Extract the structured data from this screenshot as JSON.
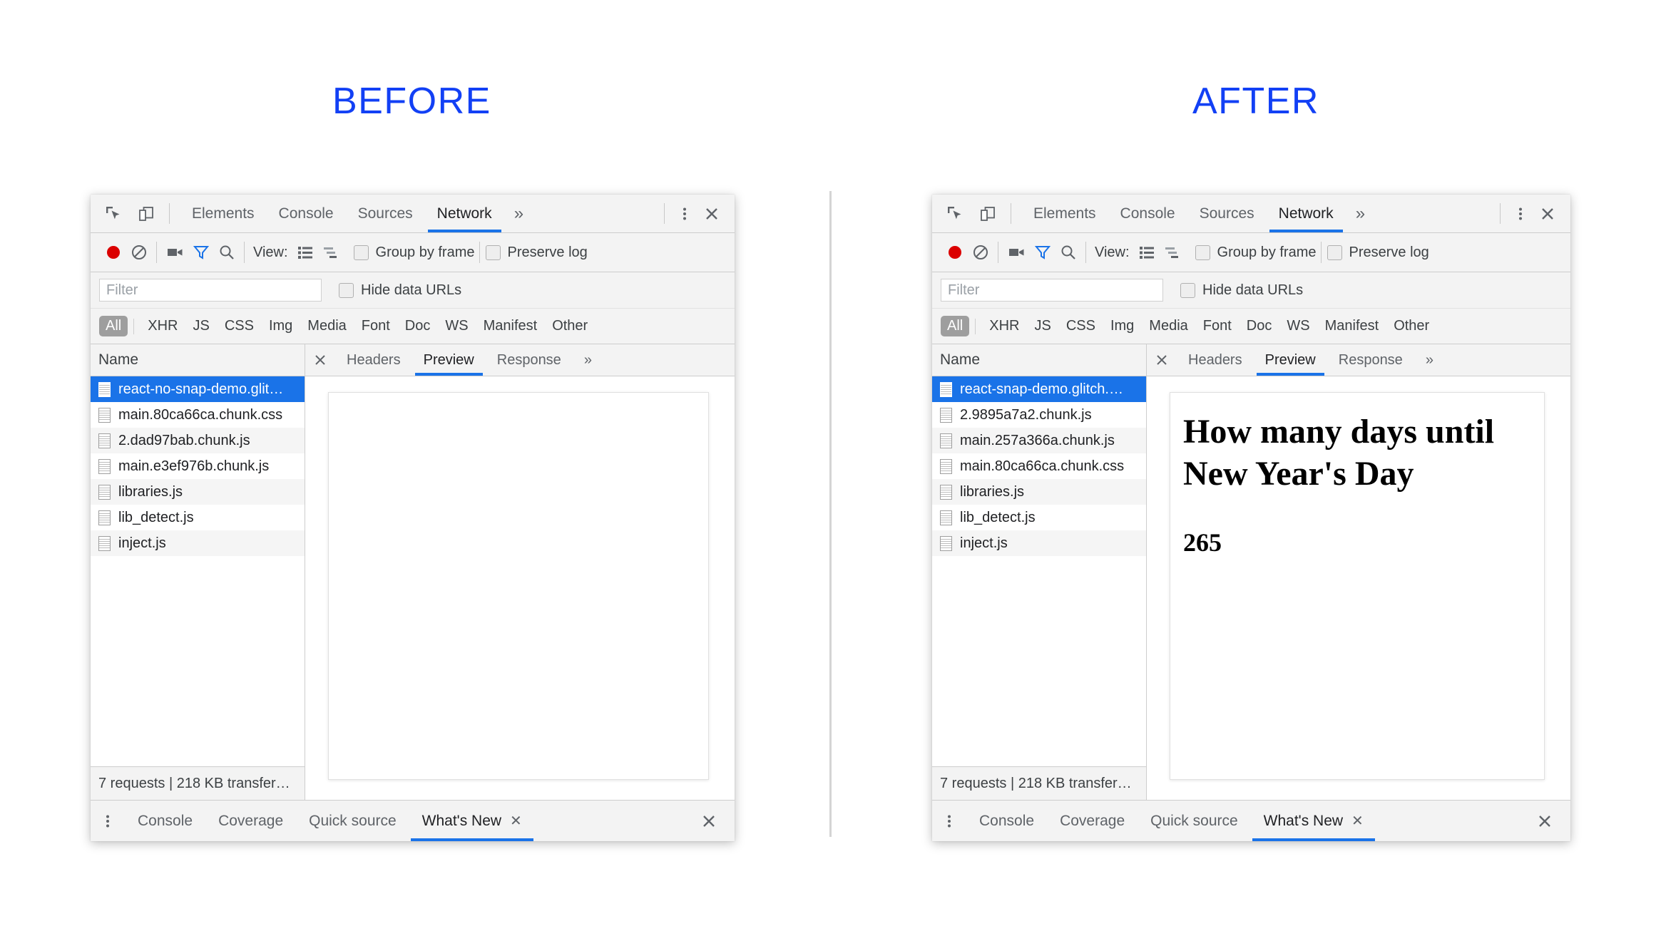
{
  "titles": {
    "before": "BEFORE",
    "after": "AFTER",
    "accent_color": "#1240f5"
  },
  "devtools": {
    "accent_color": "#1a73e8",
    "main_tabs": [
      {
        "label": "Elements",
        "active": false
      },
      {
        "label": "Console",
        "active": false
      },
      {
        "label": "Sources",
        "active": false
      },
      {
        "label": "Network",
        "active": true
      }
    ],
    "more_tabs_glyph": "»",
    "toolbar_icons": [
      "inspect-element-icon",
      "device-toolbar-icon"
    ],
    "window_icons": [
      "kebab-menu-icon",
      "close-icon"
    ],
    "network_toolbar": {
      "record_label": "record-button",
      "clear_label": "clear-button",
      "screenshot_label": "capture-screenshots-button",
      "filter_label": "filter-button",
      "search_label": "search-button",
      "view_label": "View:",
      "view_list_icon": "list-view-icon",
      "view_waterfall_icon": "waterfall-view-icon",
      "group_by_frame": "Group by frame",
      "preserve_log": "Preserve log"
    },
    "filter_bar": {
      "placeholder": "Filter",
      "value": "",
      "hide_data_urls": "Hide data URLs"
    },
    "type_filters": [
      {
        "label": "All",
        "active": true
      },
      {
        "label": "XHR",
        "active": false
      },
      {
        "label": "JS",
        "active": false
      },
      {
        "label": "CSS",
        "active": false
      },
      {
        "label": "Img",
        "active": false
      },
      {
        "label": "Media",
        "active": false
      },
      {
        "label": "Font",
        "active": false
      },
      {
        "label": "Doc",
        "active": false
      },
      {
        "label": "WS",
        "active": false
      },
      {
        "label": "Manifest",
        "active": false
      },
      {
        "label": "Other",
        "active": false
      }
    ],
    "request_column_header": "Name",
    "status_bar": "7 requests | 218 KB transfer…",
    "detail_tabs": [
      {
        "label": "Headers",
        "active": false
      },
      {
        "label": "Preview",
        "active": true
      },
      {
        "label": "Response",
        "active": false
      }
    ],
    "detail_more_glyph": "»",
    "drawer_tabs": [
      {
        "label": "Console",
        "active": false,
        "closable": false
      },
      {
        "label": "Coverage",
        "active": false,
        "closable": false
      },
      {
        "label": "Quick source",
        "active": false,
        "closable": false
      },
      {
        "label": "What's New",
        "active": true,
        "closable": true
      }
    ],
    "drawer_close_glyph": "✕"
  },
  "before": {
    "requests": [
      {
        "name": "react-no-snap-demo.glit…",
        "selected": true
      },
      {
        "name": "main.80ca66ca.chunk.css",
        "selected": false
      },
      {
        "name": "2.dad97bab.chunk.js",
        "selected": false
      },
      {
        "name": "main.e3ef976b.chunk.js",
        "selected": false
      },
      {
        "name": "libraries.js",
        "selected": false
      },
      {
        "name": "lib_detect.js",
        "selected": false
      },
      {
        "name": "inject.js",
        "selected": false
      }
    ],
    "preview": {
      "heading": "",
      "count": "",
      "empty": true
    }
  },
  "after": {
    "requests": [
      {
        "name": "react-snap-demo.glitch.…",
        "selected": true
      },
      {
        "name": "2.9895a7a2.chunk.js",
        "selected": false
      },
      {
        "name": "main.257a366a.chunk.js",
        "selected": false
      },
      {
        "name": "main.80ca66ca.chunk.css",
        "selected": false
      },
      {
        "name": "libraries.js",
        "selected": false
      },
      {
        "name": "lib_detect.js",
        "selected": false
      },
      {
        "name": "inject.js",
        "selected": false
      }
    ],
    "preview": {
      "heading": "How many days until New Year's Day",
      "count": "265",
      "empty": false
    }
  }
}
